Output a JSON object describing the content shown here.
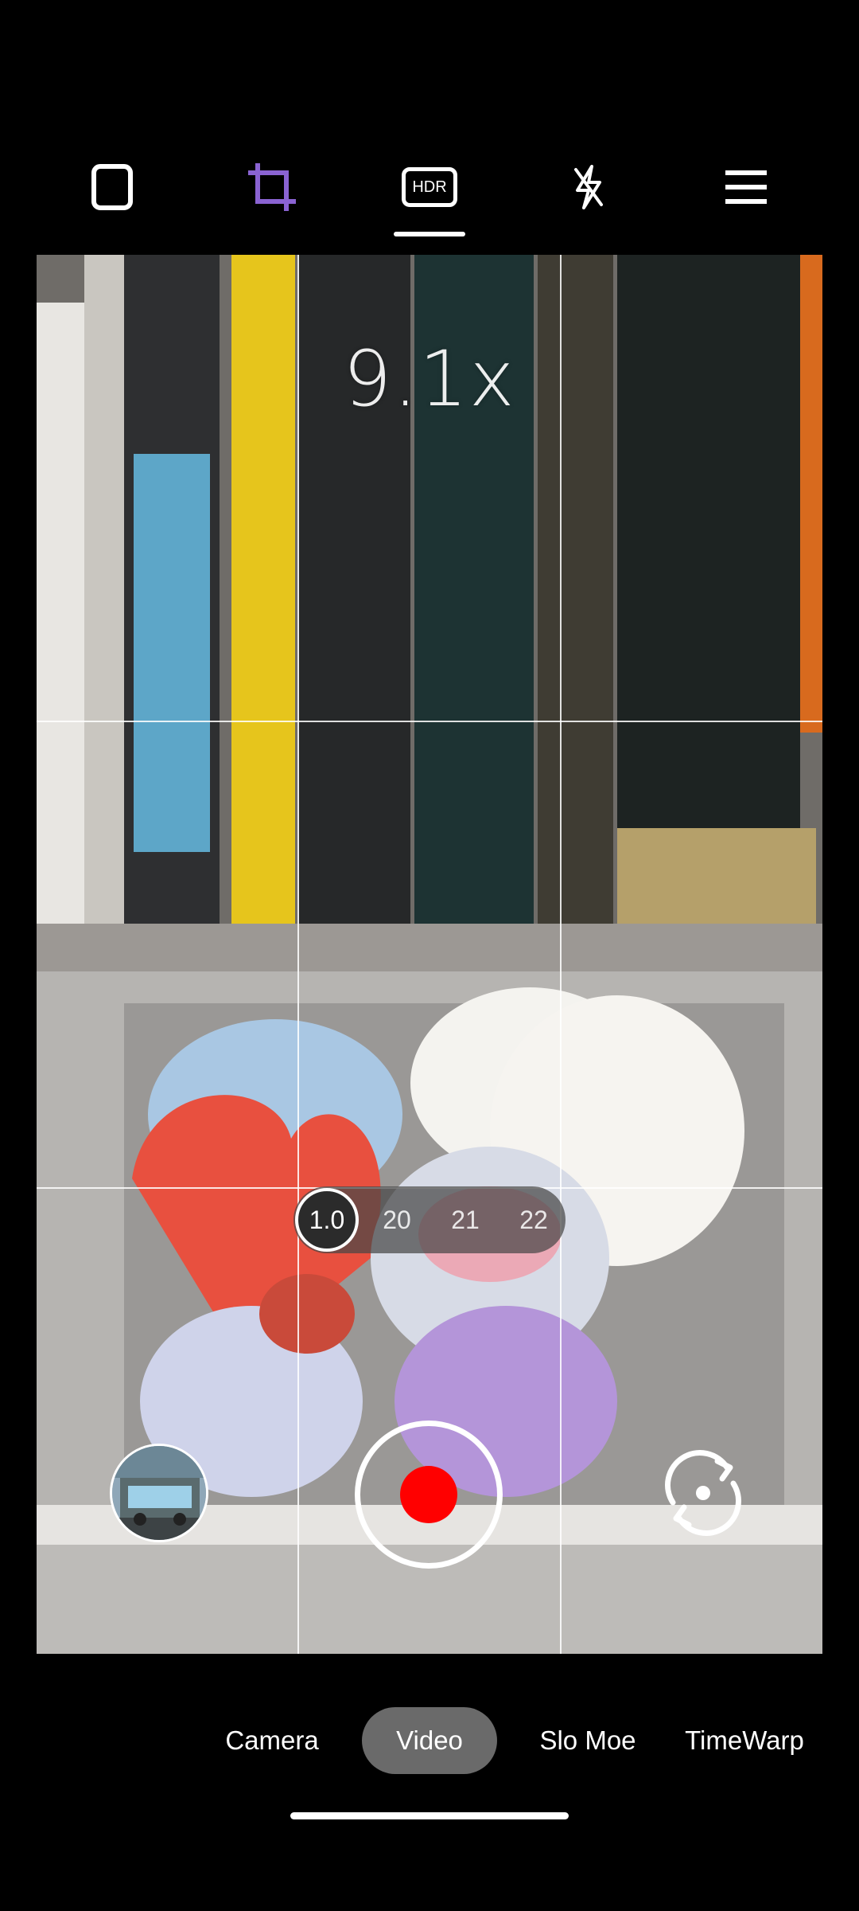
{
  "toolbar": {
    "aspect_icon": "rounded-square-icon",
    "crop_icon": "crop-icon",
    "hdr_label": "HDR",
    "flash_icon": "flash-off-icon",
    "menu_icon": "menu-icon",
    "accent_color": "#8a63d2"
  },
  "viewfinder": {
    "zoom_readout": "9.1x",
    "zoom_options": [
      "1.0",
      "20",
      "21",
      "22"
    ],
    "zoom_selected": "1.0",
    "record_color": "#ff0000",
    "gallery_icon": "gallery-thumbnail",
    "flip_icon": "flip-camera-icon"
  },
  "modes": {
    "items": [
      "Camera",
      "Video",
      "Slo Moe",
      "TimeWarp"
    ],
    "selected": "Video"
  }
}
